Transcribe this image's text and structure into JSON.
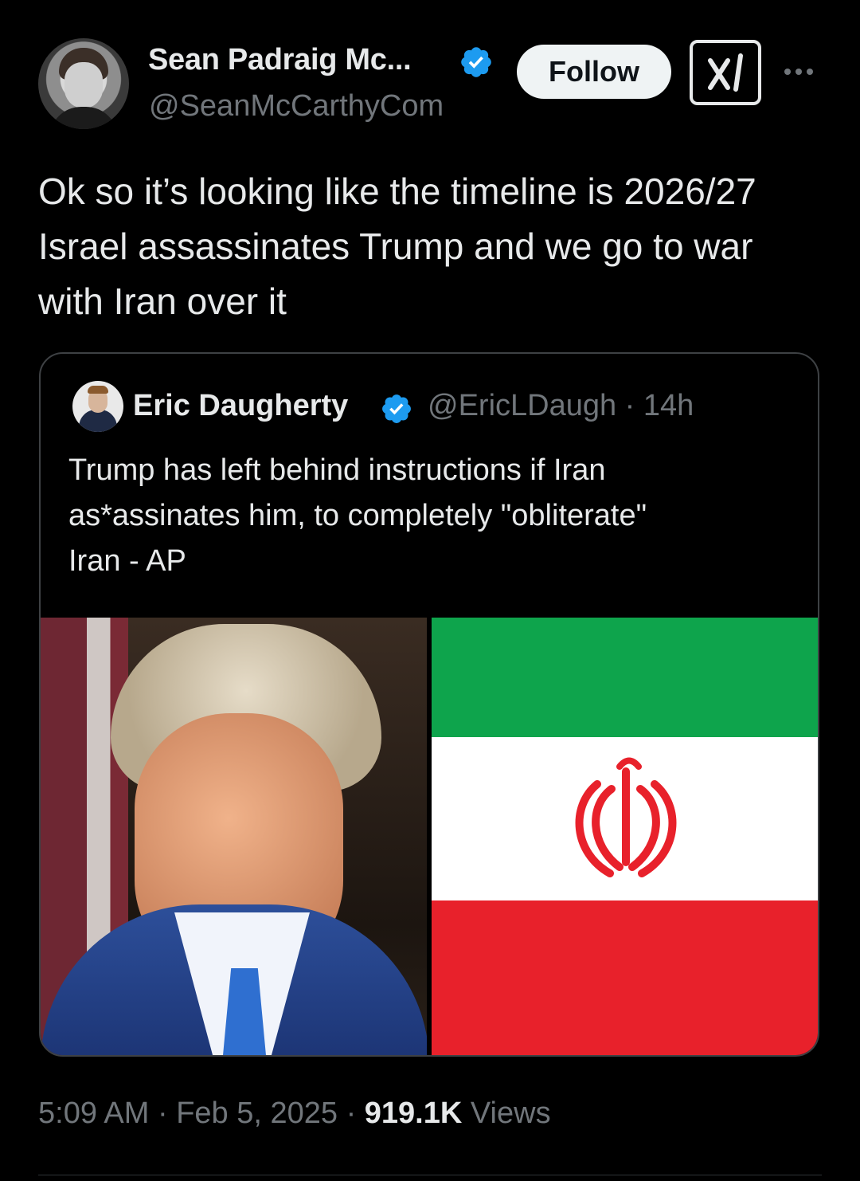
{
  "author": {
    "display_name": "Sean Padraig Mc...",
    "handle": "@SeanMcCarthyCom"
  },
  "actions": {
    "follow_label": "Follow",
    "grok_icon": "grok-icon",
    "more_icon": "more-options-icon"
  },
  "tweet": {
    "text": "Ok so it’s looking like the timeline is 2026/27\nIsrael assassinates Trump and we go to war\nwith Iran over it"
  },
  "quoted": {
    "display_name": "Eric Daugherty",
    "handle_time": "@EricLDaugh · 14h",
    "text": "Trump has left behind instructions if Iran\nas*assinates him, to completely \"obliterate\"\nIran - AP",
    "media": [
      "portrait-photo",
      "iran-flag"
    ]
  },
  "meta": {
    "time_date": "5:09 AM · Feb 5, 2025 · ",
    "views_count": "919.1K",
    "views_label": " Views"
  },
  "colors": {
    "background": "#000000",
    "text_primary": "#e7e9ea",
    "text_secondary": "#71767b",
    "verified_blue": "#1d9bf0",
    "flag_green": "#0ea44c",
    "flag_red": "#e8212b"
  }
}
